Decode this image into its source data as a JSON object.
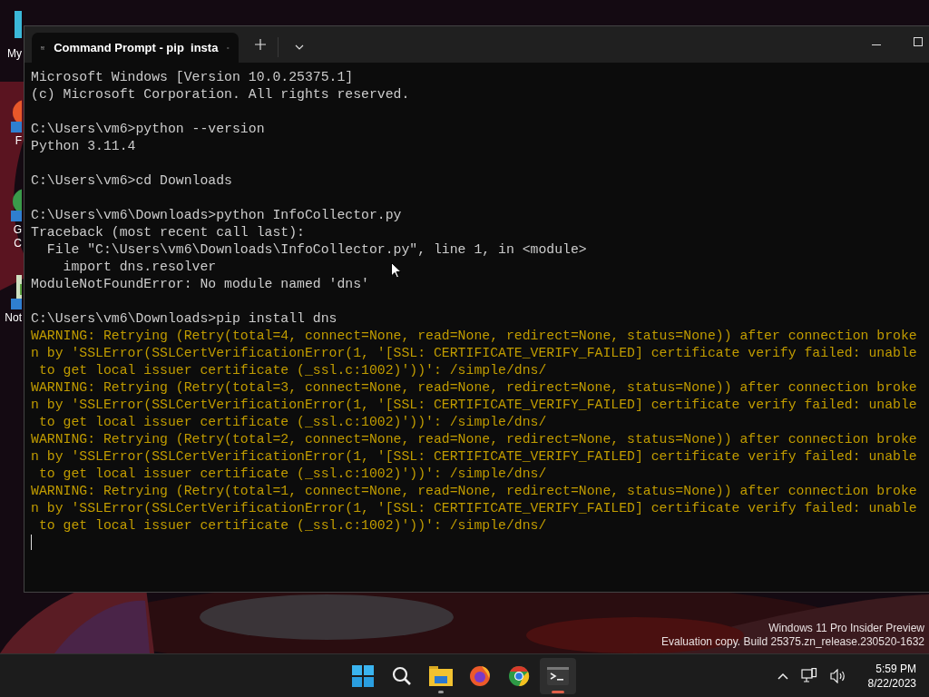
{
  "desktop_icons": [
    {
      "kind": "folder",
      "label_lines": [
        "My"
      ]
    },
    {
      "kind": "firefox",
      "label_lines": [
        "F"
      ]
    },
    {
      "kind": "chrome",
      "label_lines": [
        "G",
        "C"
      ]
    },
    {
      "kind": "notepad",
      "label_lines": [
        "Not"
      ]
    }
  ],
  "window": {
    "tab_title": "Command Prompt - pip  insta",
    "terminal": {
      "blocks": [
        {
          "lines": [
            {
              "kind": "output",
              "text": "Microsoft Windows [Version 10.0.25375.1]"
            },
            {
              "kind": "output",
              "text": "(c) Microsoft Corporation. All rights reserved."
            }
          ]
        },
        {
          "lines": [
            {
              "kind": "output",
              "text": "C:\\Users\\vm6>python --version"
            },
            {
              "kind": "output",
              "text": "Python 3.11.4"
            }
          ]
        },
        {
          "lines": [
            {
              "kind": "output",
              "text": "C:\\Users\\vm6>cd Downloads"
            }
          ]
        },
        {
          "lines": [
            {
              "kind": "output",
              "text": "C:\\Users\\vm6\\Downloads>python InfoCollector.py"
            },
            {
              "kind": "output",
              "text": "Traceback (most recent call last):"
            },
            {
              "kind": "output",
              "text": "  File \"C:\\Users\\vm6\\Downloads\\InfoCollector.py\", line 1, in <module>"
            },
            {
              "kind": "output",
              "text": "    import dns.resolver"
            },
            {
              "kind": "output",
              "text": "ModuleNotFoundError: No module named 'dns'"
            }
          ]
        },
        {
          "lines": [
            {
              "kind": "output",
              "text": "C:\\Users\\vm6\\Downloads>pip install dns"
            },
            {
              "kind": "warning",
              "text": "WARNING: Retrying (Retry(total=4, connect=None, read=None, redirect=None, status=None)) after connection broke"
            },
            {
              "kind": "warning",
              "text": "n by 'SSLError(SSLCertVerificationError(1, '[SSL: CERTIFICATE_VERIFY_FAILED] certificate verify failed: unable"
            },
            {
              "kind": "warning",
              "text": " to get local issuer certificate (_ssl.c:1002)'))': /simple/dns/"
            },
            {
              "kind": "warning",
              "text": "WARNING: Retrying (Retry(total=3, connect=None, read=None, redirect=None, status=None)) after connection broke"
            },
            {
              "kind": "warning",
              "text": "n by 'SSLError(SSLCertVerificationError(1, '[SSL: CERTIFICATE_VERIFY_FAILED] certificate verify failed: unable"
            },
            {
              "kind": "warning",
              "text": " to get local issuer certificate (_ssl.c:1002)'))': /simple/dns/"
            },
            {
              "kind": "warning",
              "text": "WARNING: Retrying (Retry(total=2, connect=None, read=None, redirect=None, status=None)) after connection broke"
            },
            {
              "kind": "warning",
              "text": "n by 'SSLError(SSLCertVerificationError(1, '[SSL: CERTIFICATE_VERIFY_FAILED] certificate verify failed: unable"
            },
            {
              "kind": "warning",
              "text": " to get local issuer certificate (_ssl.c:1002)'))': /simple/dns/"
            },
            {
              "kind": "warning",
              "text": "WARNING: Retrying (Retry(total=1, connect=None, read=None, redirect=None, status=None)) after connection broke"
            },
            {
              "kind": "warning",
              "text": "n by 'SSLError(SSLCertVerificationError(1, '[SSL: CERTIFICATE_VERIFY_FAILED] certificate verify failed: unable"
            },
            {
              "kind": "warning",
              "text": " to get local issuer certificate (_ssl.c:1002)'))': /simple/dns/"
            }
          ]
        }
      ]
    }
  },
  "watermark": [
    "Windows 11 Pro Insider Preview",
    "Evaluation copy. Build 25375.zn_release.230520-1632"
  ],
  "taskbar": {
    "apps": [
      {
        "kind": "start",
        "selected": false,
        "running": false
      },
      {
        "kind": "search",
        "selected": false,
        "running": false
      },
      {
        "kind": "explorer",
        "selected": false,
        "running": true
      },
      {
        "kind": "firefox",
        "selected": false,
        "running": false
      },
      {
        "kind": "chrome",
        "selected": false,
        "running": false
      },
      {
        "kind": "terminal",
        "selected": true,
        "running": true
      }
    ],
    "clock": {
      "time": "5:59 PM",
      "date": "8/22/2023"
    }
  }
}
